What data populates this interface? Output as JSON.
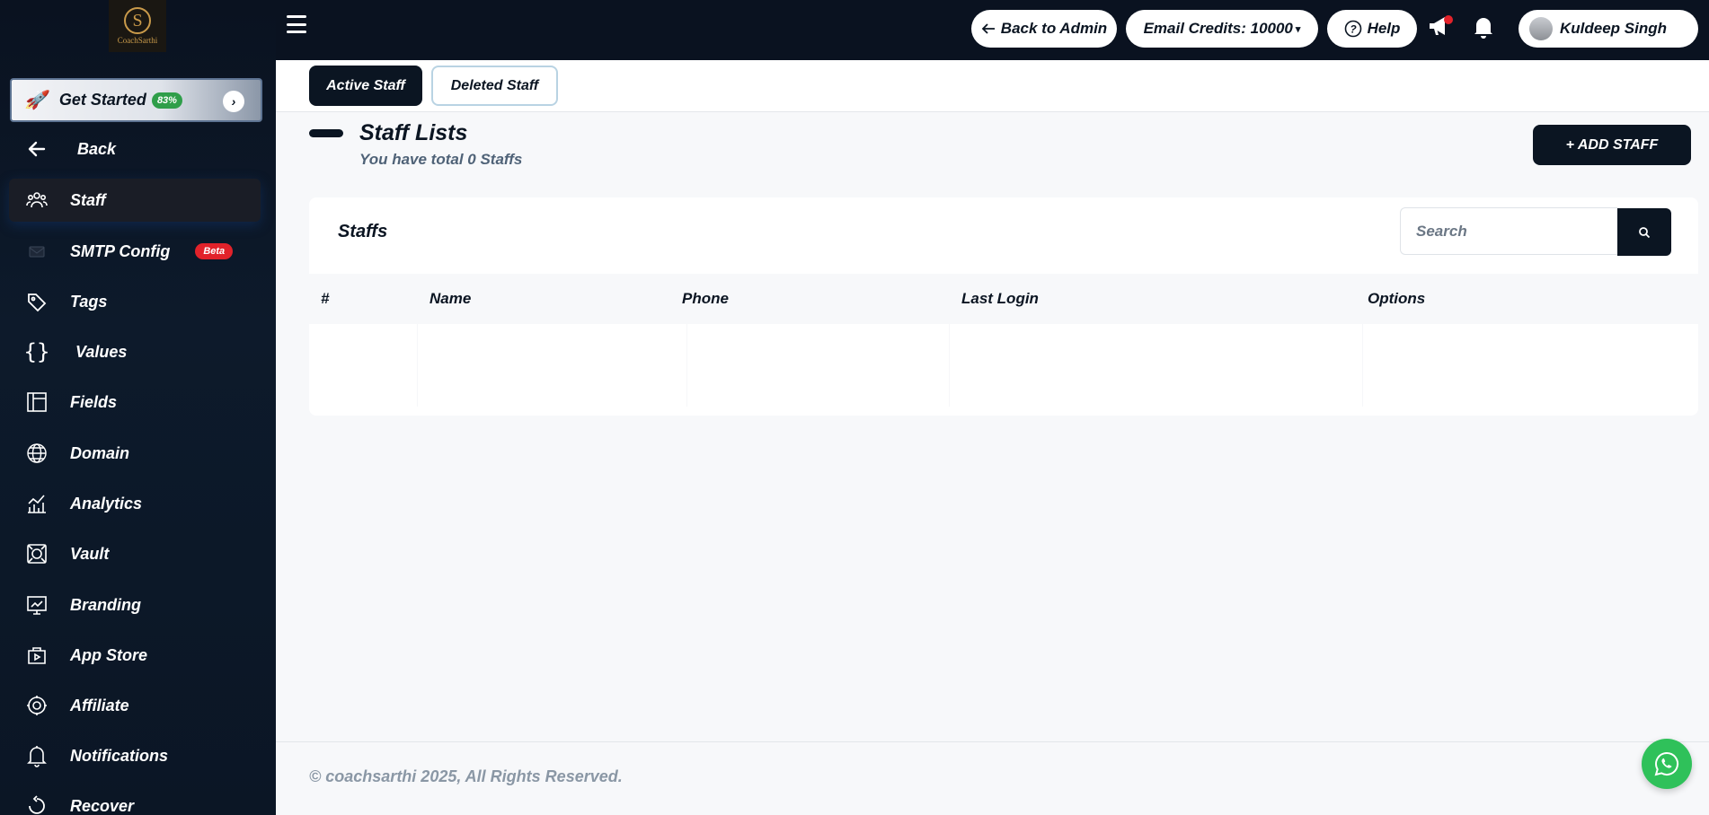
{
  "sidebar": {
    "logo_text": "CoachSarthi",
    "get_started": {
      "label": "Get Started",
      "percent": "83%"
    },
    "items": [
      {
        "label": "Back",
        "icon": "arrow-left-icon"
      },
      {
        "label": "Staff",
        "icon": "team-icon",
        "active": true
      },
      {
        "label": "SMTP Config",
        "icon": "mail-icon",
        "badge": "Beta"
      },
      {
        "label": "Tags",
        "icon": "tag-icon"
      },
      {
        "label": "Values",
        "icon": "braces-icon"
      },
      {
        "label": "Fields",
        "icon": "layout-icon"
      },
      {
        "label": "Domain",
        "icon": "globe-icon"
      },
      {
        "label": "Analytics",
        "icon": "chart-icon"
      },
      {
        "label": "Vault",
        "icon": "vault-icon"
      },
      {
        "label": "Branding",
        "icon": "branding-icon"
      },
      {
        "label": "App Store",
        "icon": "app-store-icon"
      },
      {
        "label": "Affiliate",
        "icon": "affiliate-icon"
      },
      {
        "label": "Notifications",
        "icon": "bell-icon"
      },
      {
        "label": "Recover",
        "icon": "recover-icon"
      }
    ]
  },
  "topbar": {
    "back_to_admin": "Back to Admin",
    "email_credits": "Email Credits: 10000",
    "help": "Help",
    "user_name": "Kuldeep Singh",
    "notification_dot_color": "#e2222a"
  },
  "tabs": {
    "active": "Active Staff",
    "deleted": "Deleted Staff"
  },
  "header": {
    "title": "Staff Lists",
    "subtitle": "You have total 0 Staffs",
    "add_button": "+ ADD STAFF"
  },
  "card": {
    "title": "Staffs",
    "search_placeholder": "Search",
    "columns": [
      "#",
      "Name",
      "Phone",
      "Last Login",
      "Options"
    ],
    "rows": []
  },
  "footer": {
    "copyright": "© coachsarthi 2025, All Rights Reserved."
  },
  "colors": {
    "primary": "#0b1522",
    "whatsapp": "#2fc15a",
    "beta_badge": "#e2222a",
    "progress_badge": "#2f9e4a"
  }
}
